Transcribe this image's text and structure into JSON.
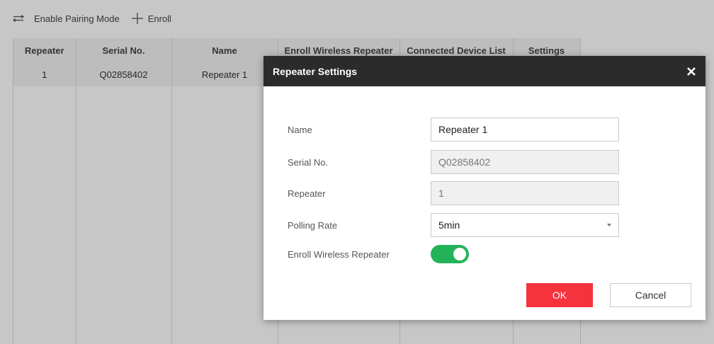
{
  "toolbar": {
    "pairing_label": "Enable Pairing Mode",
    "enroll_label": "Enroll"
  },
  "table": {
    "headers": [
      "Repeater",
      "Serial No.",
      "Name",
      "Enroll Wireless Repeater",
      "Connected Device List",
      "Settings"
    ],
    "rows": [
      [
        "1",
        "Q02858402",
        "Repeater 1",
        "",
        "",
        ""
      ]
    ]
  },
  "dialog": {
    "title": "Repeater Settings",
    "fields": {
      "name": {
        "label": "Name",
        "value": "Repeater 1"
      },
      "serial": {
        "label": "Serial No.",
        "value": "Q02858402"
      },
      "repeater": {
        "label": "Repeater",
        "value": "1"
      },
      "polling": {
        "label": "Polling Rate",
        "value": "5min"
      },
      "enroll": {
        "label": "Enroll Wireless Repeater",
        "enabled": true
      }
    },
    "ok_label": "OK",
    "cancel_label": "Cancel"
  },
  "colors": {
    "accent_red": "#f4333c",
    "toggle_green": "#22b358",
    "header_dark": "#2b2b2b"
  },
  "icons": [
    "swap-arrows-icon",
    "plus-icon",
    "close-icon",
    "chevron-down-icon"
  ]
}
